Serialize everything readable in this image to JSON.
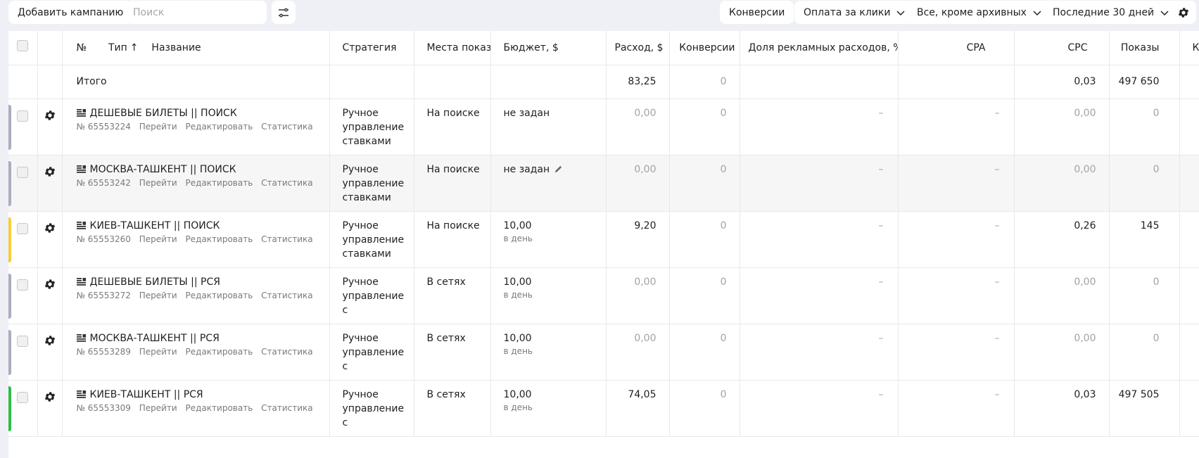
{
  "toolbar": {
    "add_campaign": "Добавить кампанию",
    "search_placeholder": "Поиск",
    "conversions": "Конверсии",
    "payment": "Оплата за клики",
    "archive_filter": "Все, кроме архивных",
    "period": "Последние 30 дней"
  },
  "headers": {
    "num": "№",
    "type": "Тип",
    "type_sort": "↑",
    "name": "Название",
    "strategy": "Стратегия",
    "places": "Места показов",
    "budget": "Бюджет, $",
    "spend": "Расход, $",
    "conversions": "Конверсии",
    "ad_share": "Доля рекламных расходов, %",
    "cpa": "CPA",
    "cpc": "CPC",
    "impressions": "Показы",
    "next": "К"
  },
  "total": {
    "label": "Итого",
    "spend": "83,25",
    "conversions": "0",
    "cpc": "0,03",
    "impressions": "497 650"
  },
  "actions": {
    "go": "Перейти",
    "edit": "Редактировать",
    "stats": "Статистика"
  },
  "campaigns": [
    {
      "name": "ДЕШЕВЫЕ БИЛЕТЫ || ПОИСК",
      "number": "№ 65553224",
      "strategy": "Ручное управление ставками",
      "places": "На поиске",
      "budget": "не задан",
      "budget_sub": "",
      "spend": "0,00",
      "conversions": "0",
      "ad_share": "–",
      "cpa": "–",
      "cpc": "0,00",
      "impressions": "0",
      "status_color": "#a9adbd"
    },
    {
      "name": "МОСКВА-ТАШКЕНТ || ПОИСК",
      "number": "№ 65553242",
      "strategy": "Ручное управление ставками",
      "places": "На поиске",
      "budget": "не задан",
      "budget_sub": "",
      "spend": "0,00",
      "conversions": "0",
      "ad_share": "–",
      "cpa": "–",
      "cpc": "0,00",
      "impressions": "0",
      "status_color": "#a9adbd"
    },
    {
      "name": "КИЕВ-ТАШКЕНТ || ПОИСК",
      "number": "№ 65553260",
      "strategy": "Ручное управление ставками",
      "places": "На поиске",
      "budget": "10,00",
      "budget_sub": "в день",
      "spend": "9,20",
      "conversions": "0",
      "ad_share": "–",
      "cpa": "–",
      "cpc": "0,26",
      "impressions": "145",
      "status_color": "#f6cd3b"
    },
    {
      "name": "ДЕШЕВЫЕ БИЛЕТЫ || РСЯ",
      "number": "№ 65553272",
      "strategy": "Ручное управление с",
      "places": "В сетях",
      "budget": "10,00",
      "budget_sub": "в день",
      "spend": "0,00",
      "conversions": "0",
      "ad_share": "–",
      "cpa": "–",
      "cpc": "0,00",
      "impressions": "0",
      "status_color": "#a9adbd"
    },
    {
      "name": "МОСКВА-ТАШКЕНТ || РСЯ",
      "number": "№ 65553289",
      "strategy": "Ручное управление с",
      "places": "В сетях",
      "budget": "10,00",
      "budget_sub": "в день",
      "spend": "0,00",
      "conversions": "0",
      "ad_share": "–",
      "cpa": "–",
      "cpc": "0,00",
      "impressions": "0",
      "status_color": "#a9adbd"
    },
    {
      "name": "КИЕВ-ТАШКЕНТ || РСЯ",
      "number": "№ 65553309",
      "strategy": "Ручное управление с",
      "places": "В сетях",
      "budget": "10,00",
      "budget_sub": "в день",
      "spend": "74,05",
      "conversions": "0",
      "ad_share": "–",
      "cpa": "–",
      "cpc": "0,03",
      "impressions": "497 505",
      "status_color": "#2fbd48"
    }
  ]
}
